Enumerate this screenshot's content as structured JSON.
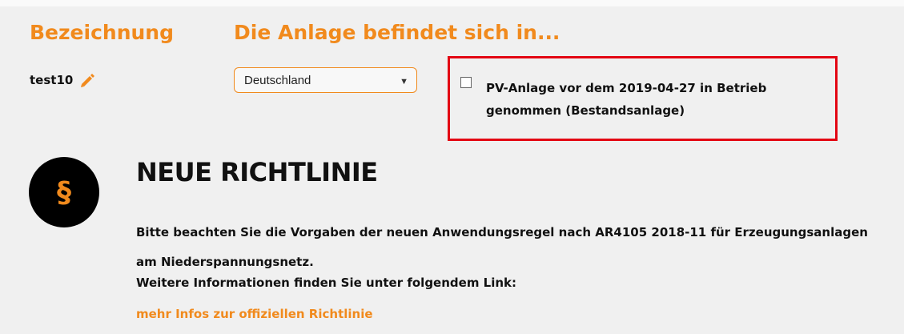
{
  "headings": {
    "name": "Bezeichnung",
    "location": "Die Anlage befindet sich in..."
  },
  "plant": {
    "name": "test10",
    "edit_icon": "pencil-icon"
  },
  "country_select": {
    "selected": "Deutschland",
    "arrow_icon": "caret-down-icon"
  },
  "existing_plant_checkbox": {
    "checked": false,
    "label": "PV-Anlage vor dem 2019-04-27 in Betrieb genommen (Bestandsanlage)"
  },
  "notice": {
    "badge_icon": "paragraph-section-icon",
    "badge_symbol": "§",
    "title": "NEUE RICHTLINIE",
    "text": "Bitte beachten Sie die Vorgaben der neuen Anwendungsregel nach AR4105 2018-11 für Erzeugungsanlagen am Niederspannungsnetz.",
    "info": "Weitere Informationen finden Sie unter folgendem Link:",
    "link_label": "mehr Infos zur offiziellen Richtlinie"
  },
  "colors": {
    "accent": "#f18a1d",
    "highlight_border": "#e30613",
    "background": "#f0f0f0"
  }
}
